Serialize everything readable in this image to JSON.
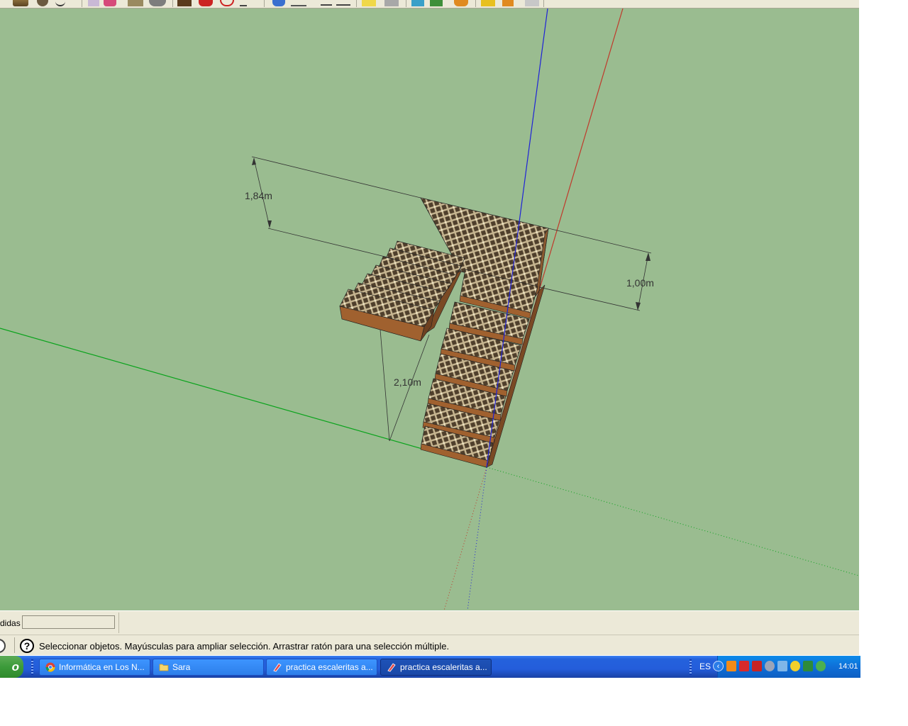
{
  "viewport": {
    "dimensions": {
      "height_dim": "1,84m",
      "depth_dim": "1,00m",
      "stair_height_dim": "2,10m"
    }
  },
  "measurements": {
    "label": "didas",
    "value": ""
  },
  "status": {
    "text": "Seleccionar objetos. Mayúsculas para ampliar selección. Arrastrar ratón para una selección múltiple.",
    "help_icon_glyph": "?"
  },
  "taskbar": {
    "start_label": "o",
    "buttons": [
      {
        "label": "Informática en Los N...",
        "icon": "chrome-icon",
        "active": false
      },
      {
        "label": "Sara",
        "icon": "folder-icon",
        "active": false
      },
      {
        "label": "practica escaleritas a...",
        "icon": "sketchup-icon",
        "active": false
      },
      {
        "label": "practica escaleritas a...",
        "icon": "sketchup-icon",
        "active": true
      }
    ],
    "language": "ES",
    "tray_chevron": "‹",
    "clock": "14:01"
  },
  "colors": {
    "viewport_bg": "#9abc90",
    "axis_red": "#c0392b",
    "axis_green": "#0aa31c",
    "axis_blue": "#1f22d8",
    "taskbar_blue": "#245ddb",
    "tray_blue": "#0f6fd8"
  }
}
